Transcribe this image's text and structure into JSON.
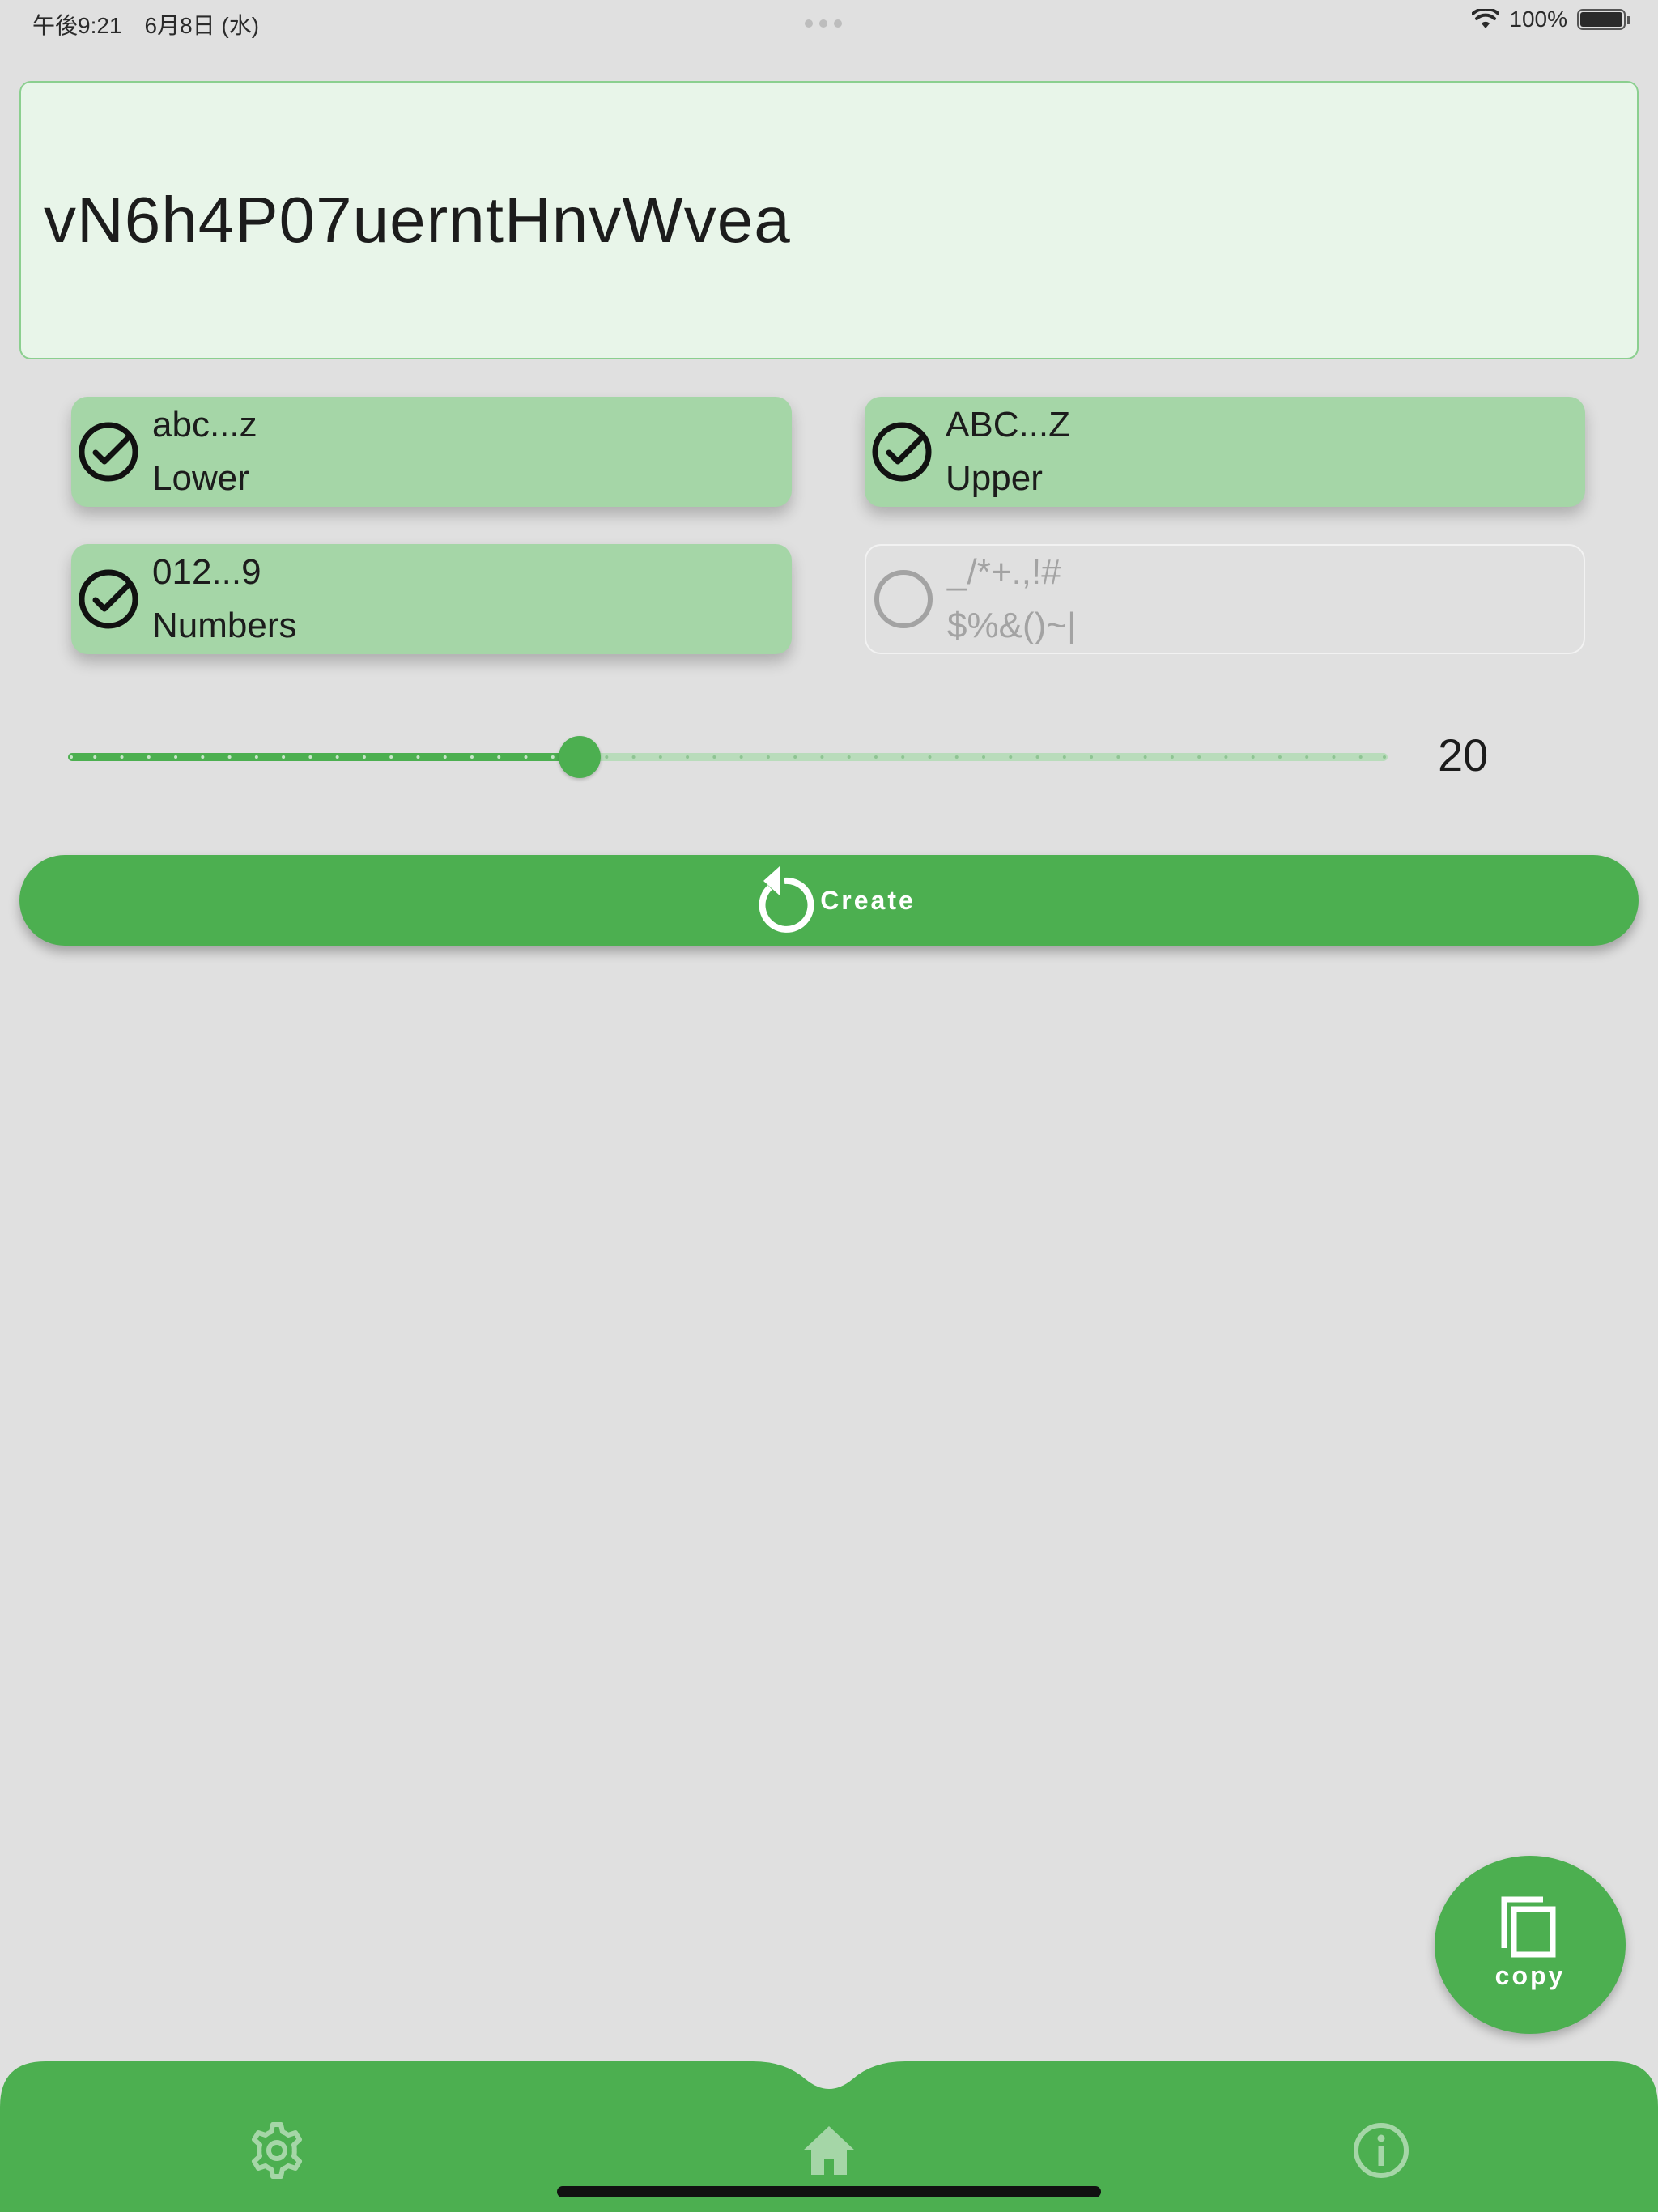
{
  "status_bar": {
    "time_date": "午後9:21　6月8日 (水)",
    "battery": "100%"
  },
  "password": {
    "value": "vN6h4P07uerntHnvWvea"
  },
  "options": [
    {
      "chars": "abc...z",
      "label": "Lower",
      "checked": true
    },
    {
      "chars": "ABC...Z",
      "label": "Upper",
      "checked": true
    },
    {
      "chars": "012...9",
      "label": "Numbers",
      "checked": true
    },
    {
      "chars": "_/*+.,!#",
      "label": "$%&()~|",
      "checked": false
    }
  ],
  "length_slider": {
    "value": 20,
    "display": "20"
  },
  "create_button": {
    "label": "Create",
    "icon": "refresh-icon"
  },
  "copy_fab": {
    "label": "copy",
    "icon": "copy-icon"
  },
  "bottom_nav": {
    "items": [
      {
        "icon": "settings-icon"
      },
      {
        "icon": "home-icon"
      },
      {
        "icon": "info-icon"
      }
    ]
  },
  "colors": {
    "accent": "#4caf50",
    "accent_light": "#a5d6a7",
    "field_bg": "#e8f5e9",
    "background": "#e0e0e0"
  }
}
